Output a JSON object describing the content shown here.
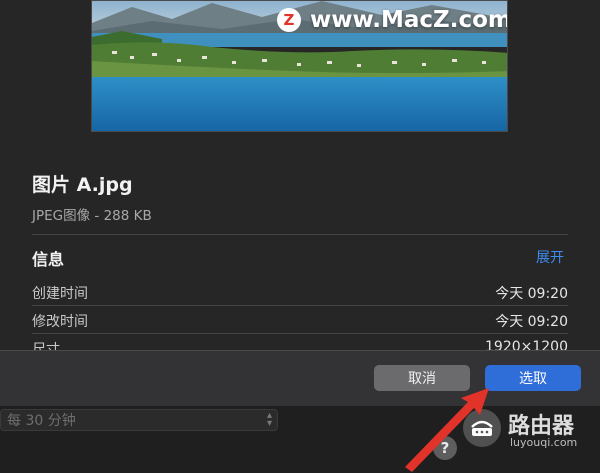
{
  "preview": {
    "watermark_text": "www.MacZ.com",
    "watermark_logo": "Z"
  },
  "file": {
    "name": "图片 A.jpg",
    "kind": "JPEG图像 - 288 KB"
  },
  "info": {
    "title": "信息",
    "expand_label": "展开",
    "rows": [
      {
        "label": "创建时间",
        "value": "今天 09:20"
      },
      {
        "label": "修改时间",
        "value": "今天 09:20"
      },
      {
        "label": "尺寸",
        "value": "1920×1200"
      }
    ]
  },
  "buttons": {
    "cancel": "取消",
    "choose": "选取"
  },
  "behind": {
    "interval_value": "每 30 分钟",
    "help": "?"
  },
  "corner_watermark": {
    "text": "路由器",
    "sub": "luyouqi.com"
  },
  "colors": {
    "accent": "#2f6ed8",
    "link": "#3f8cf2",
    "arrow": "#e2332a"
  }
}
